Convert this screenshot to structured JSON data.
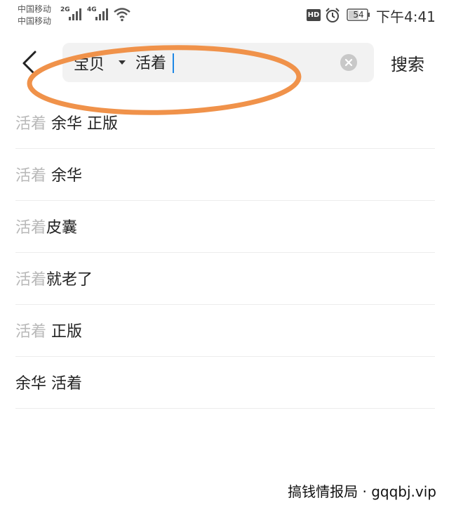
{
  "status_bar": {
    "carrier_1": "中国移动",
    "carrier_2": "中国移动",
    "net_1": "2G",
    "net_2": "4G",
    "hd": "HD",
    "battery": "54",
    "time": "下午4:41"
  },
  "search": {
    "scope_label": "宝贝",
    "query": "活着",
    "submit_label": "搜索"
  },
  "suggestions": [
    {
      "match": "活着",
      "rest": " 余华 正版"
    },
    {
      "match": "活着",
      "rest": " 余华"
    },
    {
      "match": "活着",
      "rest": "皮囊"
    },
    {
      "match": "活着",
      "rest": "就老了"
    },
    {
      "match": "活着",
      "rest": " 正版"
    },
    {
      "match": "",
      "rest": "余华 活着"
    }
  ],
  "watermark": "搞钱情报局 · gqqbj.vip",
  "colors": {
    "annotation": "#f0924a",
    "highlight_text": "#b8b8b8",
    "cursor": "#1e88e5"
  }
}
